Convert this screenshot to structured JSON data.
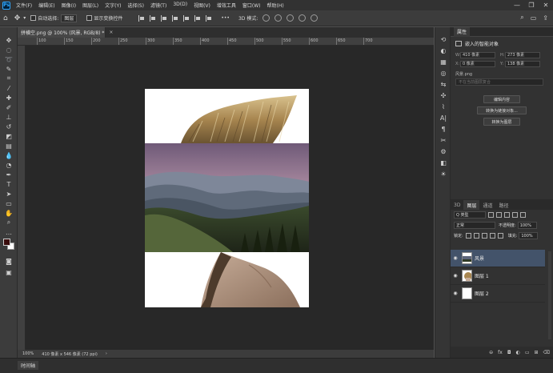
{
  "app": {
    "logo": "Ps",
    "menu": [
      "文件(F)",
      "编辑(E)",
      "图像(I)",
      "图层(L)",
      "文字(Y)",
      "选择(S)",
      "滤镜(T)",
      "3D(D)",
      "视图(V)",
      "增效工具",
      "窗口(W)",
      "帮助(H)"
    ],
    "window_controls": [
      "—",
      "❐",
      "✕"
    ]
  },
  "options": {
    "auto_select_label": "自动选择:",
    "auto_select_value": "图层",
    "show_transform_label": "显示变换控件",
    "more": "•••",
    "mode_3d": "3D 模式:"
  },
  "document": {
    "tab_title": "拼横空.png @ 100% (风景, RGB/8) *",
    "tab_close": "×",
    "zoom": "100%",
    "doc_info": "410 像素 x 546 像素 (72 ppi)",
    "status_arrow": "›"
  },
  "ruler_top": [
    "100",
    "150",
    "200",
    "250",
    "300",
    "350",
    "400",
    "450",
    "500",
    "550",
    "600",
    "650",
    "700"
  ],
  "bottom": {
    "timeline_tab": "时间轴"
  },
  "properties": {
    "tab": "属性",
    "type_label": "嵌入的智能对象",
    "w_label": "W:",
    "w_value": "410 像素",
    "h_label": "H:",
    "h_value": "273 像素",
    "x_label": "X:",
    "x_value": "0 像素",
    "y_label": "Y:",
    "y_value": "138 像素",
    "file_name": "风景.png",
    "search_placeholder": "不在当前图层复合",
    "btn_edit": "编辑内容",
    "btn_linked": "转换为链接对象...",
    "btn_convert": "转换为图层"
  },
  "layers": {
    "tabs": [
      "3D",
      "图层",
      "通道",
      "路径"
    ],
    "active_tab": "图层",
    "filter_label": "Q 类型",
    "blend_mode": "正常",
    "opacity_label": "不透明度:",
    "opacity_value": "100%",
    "lock_label": "锁定:",
    "fill_label": "填充:",
    "fill_value": "100%",
    "items": [
      {
        "name": "风景",
        "selected": true,
        "visible": true
      },
      {
        "name": "图层 1",
        "selected": false,
        "visible": true
      },
      {
        "name": "图层 2",
        "selected": false,
        "visible": true
      }
    ],
    "bottom_icons": [
      "link-icon",
      "fx-icon",
      "mask-icon",
      "adjustment-icon",
      "group-icon",
      "new-layer-icon",
      "trash-icon"
    ],
    "bottom_glyphs": [
      "⊖",
      "fx",
      "◘",
      "◐",
      "▭",
      "⊞",
      "🗑"
    ]
  },
  "colors": {
    "foreground": "#3a0d0d",
    "background": "#ffffff",
    "selected_layer": "#43536a"
  }
}
